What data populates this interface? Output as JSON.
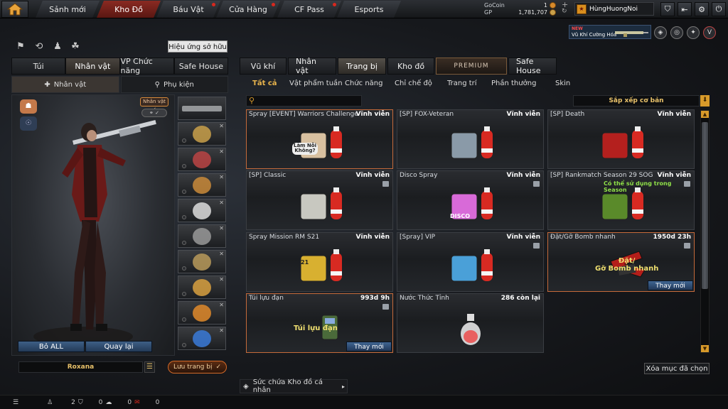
{
  "topnav": {
    "tabs": [
      {
        "label": "Sảnh mới",
        "dot": false
      },
      {
        "label": "Kho Đồ",
        "dot": false
      },
      {
        "label": "Báu Vật",
        "dot": true
      },
      {
        "label": "Cửa Hàng",
        "dot": true
      },
      {
        "label": "CF Pass",
        "dot": true
      },
      {
        "label": "Esports",
        "dot": false
      }
    ],
    "active": "Kho Đồ"
  },
  "currency": {
    "gocoin_label": "GoCoin",
    "gocoin_value": "1",
    "gp_label": "GP",
    "gp_value": "1,781,707"
  },
  "user": {
    "name": "HùngHuongNoi"
  },
  "banner": {
    "badge": "NEW",
    "text": "Vũ Khí Cường Hóa"
  },
  "left": {
    "effect_button": "Hiệu ứng sở hữu",
    "tabs": [
      "Túi",
      "Nhân vật",
      "VP Chức năng",
      "Safe House"
    ],
    "active_tab": "Nhân vật",
    "subtabs": [
      "Nhân vật",
      "Phụ kiện"
    ],
    "char_tag": "Nhân vật",
    "reset_all": "Bỏ ALL",
    "back": "Quay lại",
    "character_name": "Roxana",
    "save": "Lưu trang bị"
  },
  "right": {
    "categories": [
      "Vũ khí",
      "Nhân vật",
      "Trang bị",
      "Kho đồ",
      "PREMIUM",
      "Safe House"
    ],
    "active_category": "Trang bị",
    "filters": [
      "Tất cả",
      "Vật phẩm tuần",
      "Chức năng",
      "Chỉ chế độ",
      "Trang trí",
      "Phần thưởng",
      "Skin"
    ],
    "active_filter": "Tất cả",
    "sort": "Sắp xếp cơ bản",
    "items": [
      {
        "name": "Spray [EVENT] Warriors Challenge",
        "duration": "Vĩnh viễn",
        "icon": "chibi-spray-icon",
        "caption": "Làm Nỗi\nKhông?",
        "selected": true
      },
      {
        "name": "[SP] FOX-Veteran",
        "duration": "Vĩnh viễn",
        "icon": "fox-badge-icon",
        "selected": false
      },
      {
        "name": "[SP] Death",
        "duration": "Vĩnh viễn",
        "icon": "skull-hood-icon",
        "selected": false
      },
      {
        "name": "[SP] Classic",
        "duration": "Vĩnh viễn",
        "icon": "dog-tags-icon",
        "lock": true,
        "selected": false
      },
      {
        "name": "Disco Spray",
        "duration": "Vĩnh viễn",
        "icon": "disco-ball-icon",
        "lock": true,
        "caption": "DISCO",
        "selected": false
      },
      {
        "name": "[SP] Rankmatch Season 29 SOG",
        "duration": "Vĩnh viễn",
        "icon": "rank-emblem-icon",
        "note": "Có thể sử dụng trong Season",
        "lock": true,
        "selected": false
      },
      {
        "name": "Spray Mission RM S21",
        "duration": "Vĩnh viễn",
        "icon": "diamond-rank-icon",
        "caption": "21",
        "selected": false
      },
      {
        "name": "[Spray] VIP",
        "duration": "Vĩnh viễn",
        "icon": "vip-badge-icon",
        "lock": true,
        "selected": false
      },
      {
        "name": "Đặt/Gỡ Bomb nhanh",
        "duration": "1950d 23h",
        "icon": "bomb-arrow-icon",
        "caption": "Đặt/\nGỡ Bomb nhanh",
        "lock": true,
        "change": "Thay mới",
        "selected": true
      },
      {
        "name": "Túi lựu đạn",
        "duration": "993d 9h",
        "icon": "grenade-pouch-icon",
        "caption": "Túi lựu đạn",
        "lock": true,
        "change": "Thay mới",
        "selected": true
      },
      {
        "name": "Nước Thức Tỉnh",
        "duration": "286 còn lại",
        "icon": "potion-icon",
        "selected": false
      }
    ],
    "clear_selected": "Xóa mục đã chọn",
    "capacity_label": "Sức chứa Kho đồ cá nhân"
  },
  "bottombar": {
    "count_a": "2",
    "count_b": "0",
    "count_c": "0",
    "count_d": "0"
  },
  "colors": {
    "active_tab_red": "#8a2a22",
    "filter_active": "#e9b44c",
    "permanent_text": "#ffffff",
    "season_note": "#8fe048",
    "accent_orange": "#d89a2a"
  }
}
